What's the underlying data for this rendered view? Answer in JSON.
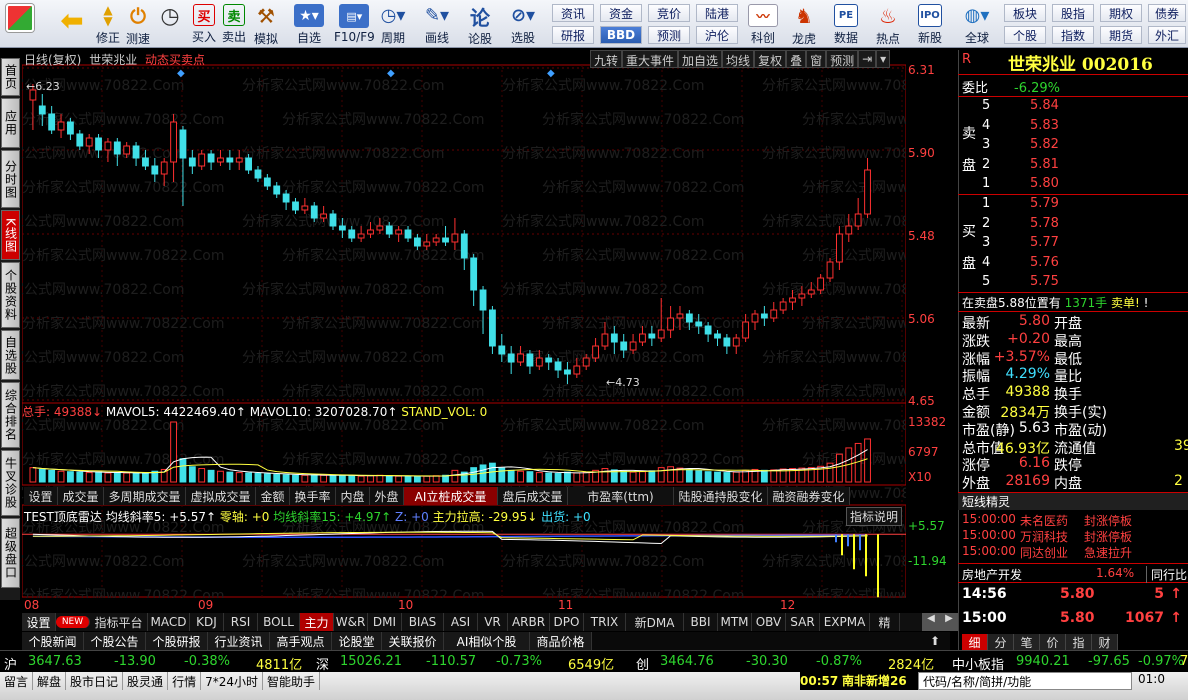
{
  "toolbar": {
    "buttons": [
      {
        "label": "",
        "icon": "grid-icon"
      },
      {
        "label": "",
        "icon": "back-icon"
      },
      {
        "label": "修正",
        "icon": "up-down-icon"
      },
      {
        "label": "测速",
        "icon": "speed-icon"
      },
      {
        "label": "",
        "icon": "clock-icon"
      },
      {
        "label": "买入",
        "icon": "buy-icon"
      },
      {
        "label": "卖出",
        "icon": "sell-icon"
      },
      {
        "label": "模拟",
        "icon": "hammer-icon"
      },
      {
        "label": "自选",
        "icon": "star-icon"
      },
      {
        "label": "F10/F9",
        "icon": "f10-icon"
      },
      {
        "label": "周期",
        "icon": "cycle-icon"
      },
      {
        "label": "画线",
        "icon": "pen-icon"
      },
      {
        "label": "论股",
        "icon": "chat-icon"
      },
      {
        "label": "选股",
        "icon": "select-icon"
      }
    ],
    "grid_buttons": [
      [
        "资讯",
        "资金",
        "竞价",
        "陆港"
      ],
      [
        "研报",
        "BBD",
        "预测",
        "沪伦"
      ]
    ],
    "right_buttons": [
      {
        "label": "科创",
        "icon": "chart-icon"
      },
      {
        "label": "龙虎",
        "icon": "tiger-icon"
      },
      {
        "label": "数据",
        "icon": "pe-icon"
      },
      {
        "label": "热点",
        "icon": "hot-icon"
      },
      {
        "label": "新股",
        "icon": "new-icon"
      },
      {
        "label": "全球",
        "icon": "globe-icon"
      }
    ],
    "right_grid": [
      [
        "板块",
        "股指",
        "期权",
        "债券"
      ],
      [
        "个股",
        "指数",
        "期货",
        "外汇"
      ]
    ]
  },
  "leftnav": [
    "首页",
    "应用",
    "分时图",
    "K线图",
    "个股资料",
    "自选股",
    "综合排名",
    "牛叉诊股",
    "超级盘口"
  ],
  "chart": {
    "header": {
      "period": "日线(复权)",
      "name": "世荣兆业",
      "signal": "动态买卖点"
    },
    "top_tabs": [
      "九转",
      "重大事件",
      "加自选",
      "均线",
      "复权",
      "叠",
      "窗",
      "预测"
    ],
    "price_ticks": [
      "6.31",
      "5.90",
      "5.48",
      "5.06",
      "4.65"
    ],
    "max_label": "6.23",
    "min_label": "4.73",
    "vol_header": {
      "a": "总手: 49388↓",
      "b": "MAVOL5: 4422469.40↑",
      "c": "MAVOL10: 3207028.70↑",
      "d": "STAND_VOL: 0"
    },
    "vol_ticks": [
      "13382",
      "6797",
      "X10"
    ],
    "mid_tabs": [
      "设置",
      "成交量",
      "多周期成交量",
      "虚拟成交量",
      "金额",
      "换手率",
      "内盘",
      "外盘",
      "AI立桩成交量",
      "盘后成交量",
      "市盈率(ttm)",
      "陆股通持股变化",
      "融资融券变化"
    ],
    "ind_header": {
      "a": "TEST顶底雷达",
      "b": "均线斜率5: +5.57↑",
      "c": "零轴: +0",
      "d": "均线斜率15: +4.97↑",
      "e": "Z: +0",
      "f": "主力拉高: -29.95↓",
      "g": "出货: +0",
      "btn": "指标说明"
    },
    "ind_ticks": [
      "+5.57",
      "-11.94"
    ],
    "months": [
      "08",
      "09",
      "10",
      "11",
      "12"
    ],
    "watermark": "分析家公式网www.70822.Com",
    "bottom_tabs": [
      "设置",
      "NEW",
      "指标平台",
      "MACD",
      "KDJ",
      "RSI",
      "BOLL",
      "主力",
      "W&R",
      "DMI",
      "BIAS",
      "ASI",
      "VR",
      "ARBR",
      "DPO",
      "TRIX",
      "新DMA",
      "BBI",
      "MTM",
      "OBV",
      "SAR",
      "EXPMA",
      "精"
    ],
    "news_tabs": [
      "个股新闻",
      "个股公告",
      "个股研报",
      "行业资讯",
      "高手观点",
      "论股堂",
      "关联报价",
      "AI相似个股",
      "商品价格"
    ]
  },
  "chart_data": {
    "type": "candlestick",
    "ylim": [
      4.65,
      6.31
    ],
    "candles": [
      [
        6.15,
        6.2,
        6.23,
        6.0
      ],
      [
        6.12,
        6.08,
        6.18,
        6.02
      ],
      [
        6.08,
        6.0,
        6.12,
        5.98
      ],
      [
        6.0,
        6.04,
        6.08,
        5.96
      ],
      [
        6.04,
        5.98,
        6.06,
        5.95
      ],
      [
        5.98,
        5.92,
        6.0,
        5.9
      ],
      [
        5.92,
        5.96,
        5.98,
        5.88
      ],
      [
        5.96,
        5.9,
        5.98,
        5.86
      ],
      [
        5.9,
        5.94,
        5.96,
        5.84
      ],
      [
        5.94,
        5.88,
        5.96,
        5.82
      ],
      [
        5.88,
        5.92,
        5.94,
        5.86
      ],
      [
        5.92,
        5.86,
        5.94,
        5.82
      ],
      [
        5.86,
        5.82,
        5.9,
        5.8
      ],
      [
        5.82,
        5.78,
        5.86,
        5.74
      ],
      [
        5.78,
        5.84,
        5.86,
        5.72
      ],
      [
        5.84,
        6.04,
        6.08,
        5.74
      ],
      [
        6.0,
        5.86,
        6.02,
        5.62
      ],
      [
        5.86,
        5.82,
        5.9,
        5.78
      ],
      [
        5.82,
        5.88,
        5.9,
        5.8
      ],
      [
        5.88,
        5.84,
        5.9,
        5.8
      ],
      [
        5.84,
        5.86,
        5.9,
        5.82
      ],
      [
        5.86,
        5.84,
        5.9,
        5.8
      ],
      [
        5.84,
        5.86,
        5.9,
        5.8
      ],
      [
        5.86,
        5.8,
        5.88,
        5.78
      ],
      [
        5.8,
        5.76,
        5.82,
        5.74
      ],
      [
        5.76,
        5.72,
        5.78,
        5.7
      ],
      [
        5.72,
        5.68,
        5.74,
        5.66
      ],
      [
        5.68,
        5.64,
        5.7,
        5.6
      ],
      [
        5.64,
        5.6,
        5.66,
        5.58
      ],
      [
        5.6,
        5.62,
        5.66,
        5.58
      ],
      [
        5.62,
        5.56,
        5.64,
        5.54
      ],
      [
        5.56,
        5.58,
        5.62,
        5.54
      ],
      [
        5.58,
        5.52,
        5.6,
        5.5
      ],
      [
        5.52,
        5.5,
        5.56,
        5.46
      ],
      [
        5.5,
        5.46,
        5.52,
        5.44
      ],
      [
        5.46,
        5.48,
        5.52,
        5.44
      ],
      [
        5.48,
        5.5,
        5.54,
        5.46
      ],
      [
        5.5,
        5.52,
        5.56,
        5.48
      ],
      [
        5.52,
        5.48,
        5.54,
        5.46
      ],
      [
        5.48,
        5.5,
        5.52,
        5.44
      ],
      [
        5.5,
        5.46,
        5.52,
        5.44
      ],
      [
        5.46,
        5.42,
        5.48,
        5.4
      ],
      [
        5.42,
        5.44,
        5.48,
        5.4
      ],
      [
        5.44,
        5.46,
        5.48,
        5.42
      ],
      [
        5.46,
        5.44,
        5.52,
        5.42
      ],
      [
        5.44,
        5.48,
        5.56,
        5.4
      ],
      [
        5.48,
        5.36,
        5.5,
        5.3
      ],
      [
        5.36,
        5.2,
        5.38,
        5.12
      ],
      [
        5.2,
        5.1,
        5.22,
        4.98
      ],
      [
        5.1,
        4.92,
        5.12,
        4.88
      ],
      [
        4.92,
        4.88,
        4.98,
        4.84
      ],
      [
        4.88,
        4.84,
        4.92,
        4.78
      ],
      [
        4.84,
        4.88,
        4.92,
        4.82
      ],
      [
        4.88,
        4.82,
        4.9,
        4.78
      ],
      [
        4.82,
        4.86,
        4.9,
        4.8
      ],
      [
        4.86,
        4.84,
        4.88,
        4.8
      ],
      [
        4.84,
        4.8,
        4.86,
        4.76
      ],
      [
        4.8,
        4.78,
        4.84,
        4.73
      ],
      [
        4.78,
        4.82,
        4.86,
        4.76
      ],
      [
        4.82,
        4.86,
        4.88,
        4.8
      ],
      [
        4.86,
        4.92,
        4.96,
        4.84
      ],
      [
        4.92,
        4.98,
        5.04,
        4.9
      ],
      [
        4.98,
        4.94,
        5.02,
        4.88
      ],
      [
        4.94,
        4.9,
        4.98,
        4.86
      ],
      [
        4.9,
        4.94,
        4.98,
        4.88
      ],
      [
        4.94,
        4.98,
        5.02,
        4.92
      ],
      [
        4.98,
        4.96,
        5.02,
        4.92
      ],
      [
        4.96,
        5.0,
        5.16,
        4.94
      ],
      [
        5.0,
        5.06,
        5.12,
        4.96
      ],
      [
        5.06,
        5.08,
        5.12,
        5.0
      ],
      [
        5.08,
        5.04,
        5.1,
        5.0
      ],
      [
        5.04,
        5.02,
        5.08,
        4.98
      ],
      [
        5.02,
        4.98,
        5.04,
        4.94
      ],
      [
        4.98,
        4.96,
        5.0,
        4.92
      ],
      [
        4.96,
        4.92,
        4.98,
        4.88
      ],
      [
        4.92,
        4.96,
        4.98,
        4.88
      ],
      [
        4.96,
        5.04,
        5.08,
        4.94
      ],
      [
        5.04,
        5.08,
        5.1,
        5.0
      ],
      [
        5.08,
        5.06,
        5.12,
        5.02
      ],
      [
        5.06,
        5.1,
        5.14,
        5.04
      ],
      [
        5.1,
        5.14,
        5.16,
        5.08
      ],
      [
        5.14,
        5.16,
        5.2,
        5.1
      ],
      [
        5.16,
        5.18,
        5.22,
        5.12
      ],
      [
        5.18,
        5.2,
        5.24,
        5.16
      ],
      [
        5.2,
        5.26,
        5.28,
        5.18
      ],
      [
        5.26,
        5.34,
        5.36,
        5.24
      ],
      [
        5.34,
        5.48,
        5.52,
        5.3
      ],
      [
        5.48,
        5.52,
        5.58,
        5.44
      ],
      [
        5.52,
        5.58,
        5.66,
        5.5
      ],
      [
        5.58,
        5.8,
        5.86,
        5.56
      ]
    ],
    "volume_max": 13382,
    "volumes": [
      3200,
      2800,
      2600,
      2400,
      2300,
      2200,
      2100,
      2200,
      2000,
      2100,
      2000,
      1900,
      2100,
      2400,
      2800,
      13382,
      5200,
      3400,
      3000,
      2600,
      2400,
      2200,
      2100,
      2000,
      1900,
      1800,
      1700,
      1600,
      1500,
      1500,
      1600,
      1500,
      1400,
      1500,
      1400,
      1300,
      1400,
      1500,
      1400,
      1300,
      1300,
      1200,
      1300,
      1400,
      1500,
      2600,
      2200,
      3200,
      3800,
      4200,
      3100,
      2600,
      2400,
      2300,
      2100,
      2000,
      1900,
      2200,
      2000,
      2200,
      2600,
      3000,
      2700,
      2400,
      2200,
      2300,
      2500,
      3200,
      3400,
      3100,
      2800,
      2500,
      2300,
      2200,
      2100,
      2200,
      2600,
      2800,
      2600,
      2700,
      2900,
      3000,
      3100,
      3200,
      3500,
      4200,
      6200,
      7600,
      8600,
      9600
    ],
    "indicator": {
      "ticks": [
        5.57,
        -11.94
      ],
      "bars_yellow": [
        -3,
        -5,
        -6,
        -9
      ],
      "bars_blue": [
        -2,
        -3,
        -4
      ]
    }
  },
  "right_panel": {
    "title": "世荣兆业 002016",
    "weibi_label": "委比",
    "weibi": "-6.29%",
    "sell_label": "卖盘",
    "asks": [
      {
        "n": "5",
        "p": "5.84"
      },
      {
        "n": "4",
        "p": "5.83"
      },
      {
        "n": "3",
        "p": "5.82"
      },
      {
        "n": "2",
        "p": "5.81"
      },
      {
        "n": "1",
        "p": "5.80"
      }
    ],
    "buy_label": "买盘",
    "bids": [
      {
        "n": "1",
        "p": "5.79"
      },
      {
        "n": "2",
        "p": "5.78"
      },
      {
        "n": "3",
        "p": "5.77"
      },
      {
        "n": "4",
        "p": "5.76"
      },
      {
        "n": "5",
        "p": "5.75"
      }
    ],
    "alert": {
      "a": "在卖盘5.88位置有",
      "b": "1371手",
      "c": "卖单!"
    },
    "quotes": [
      {
        "l": "最新",
        "v": "5.80",
        "c": "red",
        "l2": "开盘"
      },
      {
        "l": "涨跌",
        "v": "+0.20",
        "c": "red",
        "l2": "最高"
      },
      {
        "l": "涨幅",
        "v": "+3.57%",
        "c": "red",
        "l2": "最低"
      },
      {
        "l": "振幅",
        "v": "4.29%",
        "c": "cy",
        "l2": "量比"
      },
      {
        "l": "总手",
        "v": "49388",
        "c": "yel",
        "l2": "换手"
      },
      {
        "l": "金额",
        "v": "2834万",
        "c": "yel",
        "l2": "换手(实)"
      },
      {
        "l": "市盈(静)",
        "v": "5.63",
        "c": "wht",
        "l2": "市盈(动)"
      },
      {
        "l": "总市值",
        "v": "46.93亿",
        "c": "yel",
        "l2": "流通值",
        "extra": "39"
      },
      {
        "l": "涨停",
        "v": "6.16",
        "c": "red",
        "l2": "跌停"
      },
      {
        "l": "外盘",
        "v": "28169",
        "c": "red",
        "l2": "内盘",
        "extra": "2"
      }
    ],
    "short_title": "短线精灵",
    "short": [
      {
        "t": "15:00:00",
        "n": "未名医药",
        "e": "封涨停板"
      },
      {
        "t": "15:00:00",
        "n": "万润科技",
        "e": "封涨停板"
      },
      {
        "t": "15:00:00",
        "n": "同达创业",
        "e": "急速拉升"
      }
    ],
    "sector": {
      "name": "房地产开发",
      "pct": "1.64%",
      "peer": "同行比"
    },
    "ticks": [
      {
        "t": "14:56",
        "p": "5.80",
        "v": "5",
        "arrow": "↑"
      },
      {
        "t": "15:00",
        "p": "5.80",
        "v": "1067",
        "arrow": "↑"
      }
    ],
    "bottom_tabs": [
      "细",
      "分",
      "笔",
      "价",
      "指",
      "财"
    ]
  },
  "status": {
    "row1": [
      {
        "n": "沪",
        "v": "3647.63",
        "c": "-13.90",
        "p": "-0.38%",
        "a": "4811亿"
      },
      {
        "n": "深",
        "v": "15026.21",
        "c": "-110.57",
        "p": "-0.73%",
        "a": "6549亿"
      },
      {
        "n": "创",
        "v": "3464.76",
        "c": "-30.30",
        "p": "-0.87%",
        "a": "2824亿"
      },
      {
        "n": "中小板指",
        "v": "9940.21",
        "c": "-97.65",
        "p": "-0.97%",
        "a": "7"
      }
    ],
    "row2": [
      "留言",
      "解盘",
      "股市日记",
      "股灵通",
      "行情",
      "7*24小时",
      "智能助手"
    ],
    "time": "00:57",
    "ticker": "南非新增26",
    "search": "代码/名称/简拼/功能",
    "clock": "01:0"
  }
}
